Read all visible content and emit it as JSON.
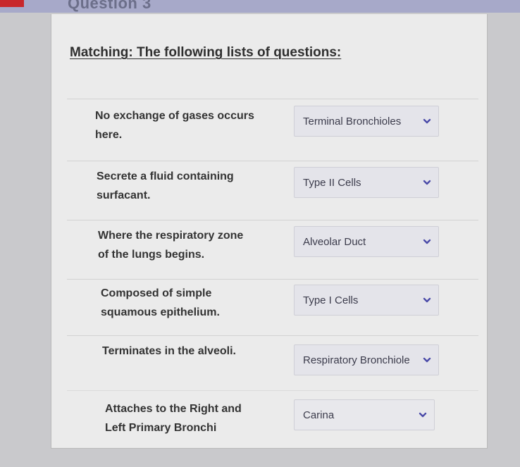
{
  "window": {
    "question_title": "Question 3"
  },
  "quiz": {
    "heading": "Matching: The following lists of questions:",
    "items": [
      {
        "prompt_line1": "No exchange of gases occurs",
        "prompt_line2": "here.",
        "answer": "Terminal Bronchioles"
      },
      {
        "prompt_line1": "Secrete a fluid containing",
        "prompt_line2": "surfacant.",
        "answer": "Type II Cells"
      },
      {
        "prompt_line1": "Where the respiratory zone",
        "prompt_line2": "of the lungs begins.",
        "answer": "Alveolar Duct"
      },
      {
        "prompt_line1": "Composed of simple",
        "prompt_line2": "squamous epithelium.",
        "answer": "Type I Cells"
      },
      {
        "prompt_line1": "Terminates in the alveoli.",
        "prompt_line2": "",
        "answer": "Respiratory Bronchiole"
      },
      {
        "prompt_line1": "Attaches to the Right and",
        "prompt_line2": "Left Primary Bronchi",
        "answer": "Carina"
      }
    ]
  },
  "colors": {
    "accent": "#5a5aa0",
    "chevron": "#4a4aa8"
  },
  "icons": {
    "dropdown": "chevron-down-icon"
  }
}
